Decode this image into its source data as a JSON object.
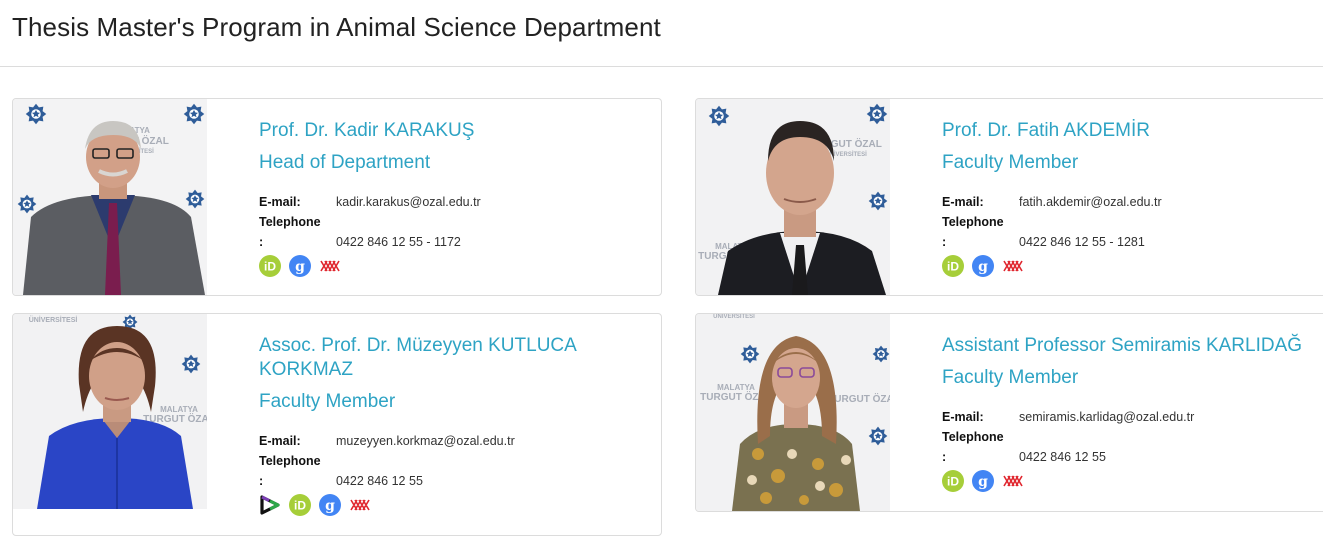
{
  "page": {
    "title": "Thesis Master's Program in Animal Science Department"
  },
  "backdrop_text": [
    "MALATYA",
    "TURGUT ÖZAL",
    "ÜNİVERSİTESİ"
  ],
  "labels": {
    "email": "E-mail:",
    "telephone": "Telephone",
    "colon": ":"
  },
  "icons": {
    "orcid": "orcid-icon",
    "scholar": "google-scholar-icon",
    "yok": "yok-academic-icon",
    "avesis": "avesis-icon"
  },
  "colors": {
    "accent": "#2ea3c4",
    "orcid": "#a6ce39",
    "scholar": "#4285f4",
    "yok": "#e0272f"
  },
  "members": [
    {
      "name": "Prof. Dr. Kadir KARAKUŞ",
      "role": "Head of Department",
      "email": "kadir.karakus@ozal.edu.tr",
      "phone": "0422 846 12 55 - 1172"
    },
    {
      "name": "Prof. Dr. Fatih AKDEMİR",
      "role": "Faculty Member",
      "email": "fatih.akdemir@ozal.edu.tr",
      "phone": "0422 846 12 55 - 1281"
    },
    {
      "name_line1": "Assoc. Prof. Dr. Müzeyyen KUTLUCA",
      "name_line2": "KORKMAZ",
      "role": "Faculty Member",
      "email": "muzeyyen.korkmaz@ozal.edu.tr",
      "phone": "0422 846 12 55"
    },
    {
      "name": "Assistant Professor Semiramis KARLIDAĞ",
      "role": "Faculty Member",
      "email": "semiramis.karlidag@ozal.edu.tr",
      "phone": "0422 846 12 55"
    }
  ]
}
